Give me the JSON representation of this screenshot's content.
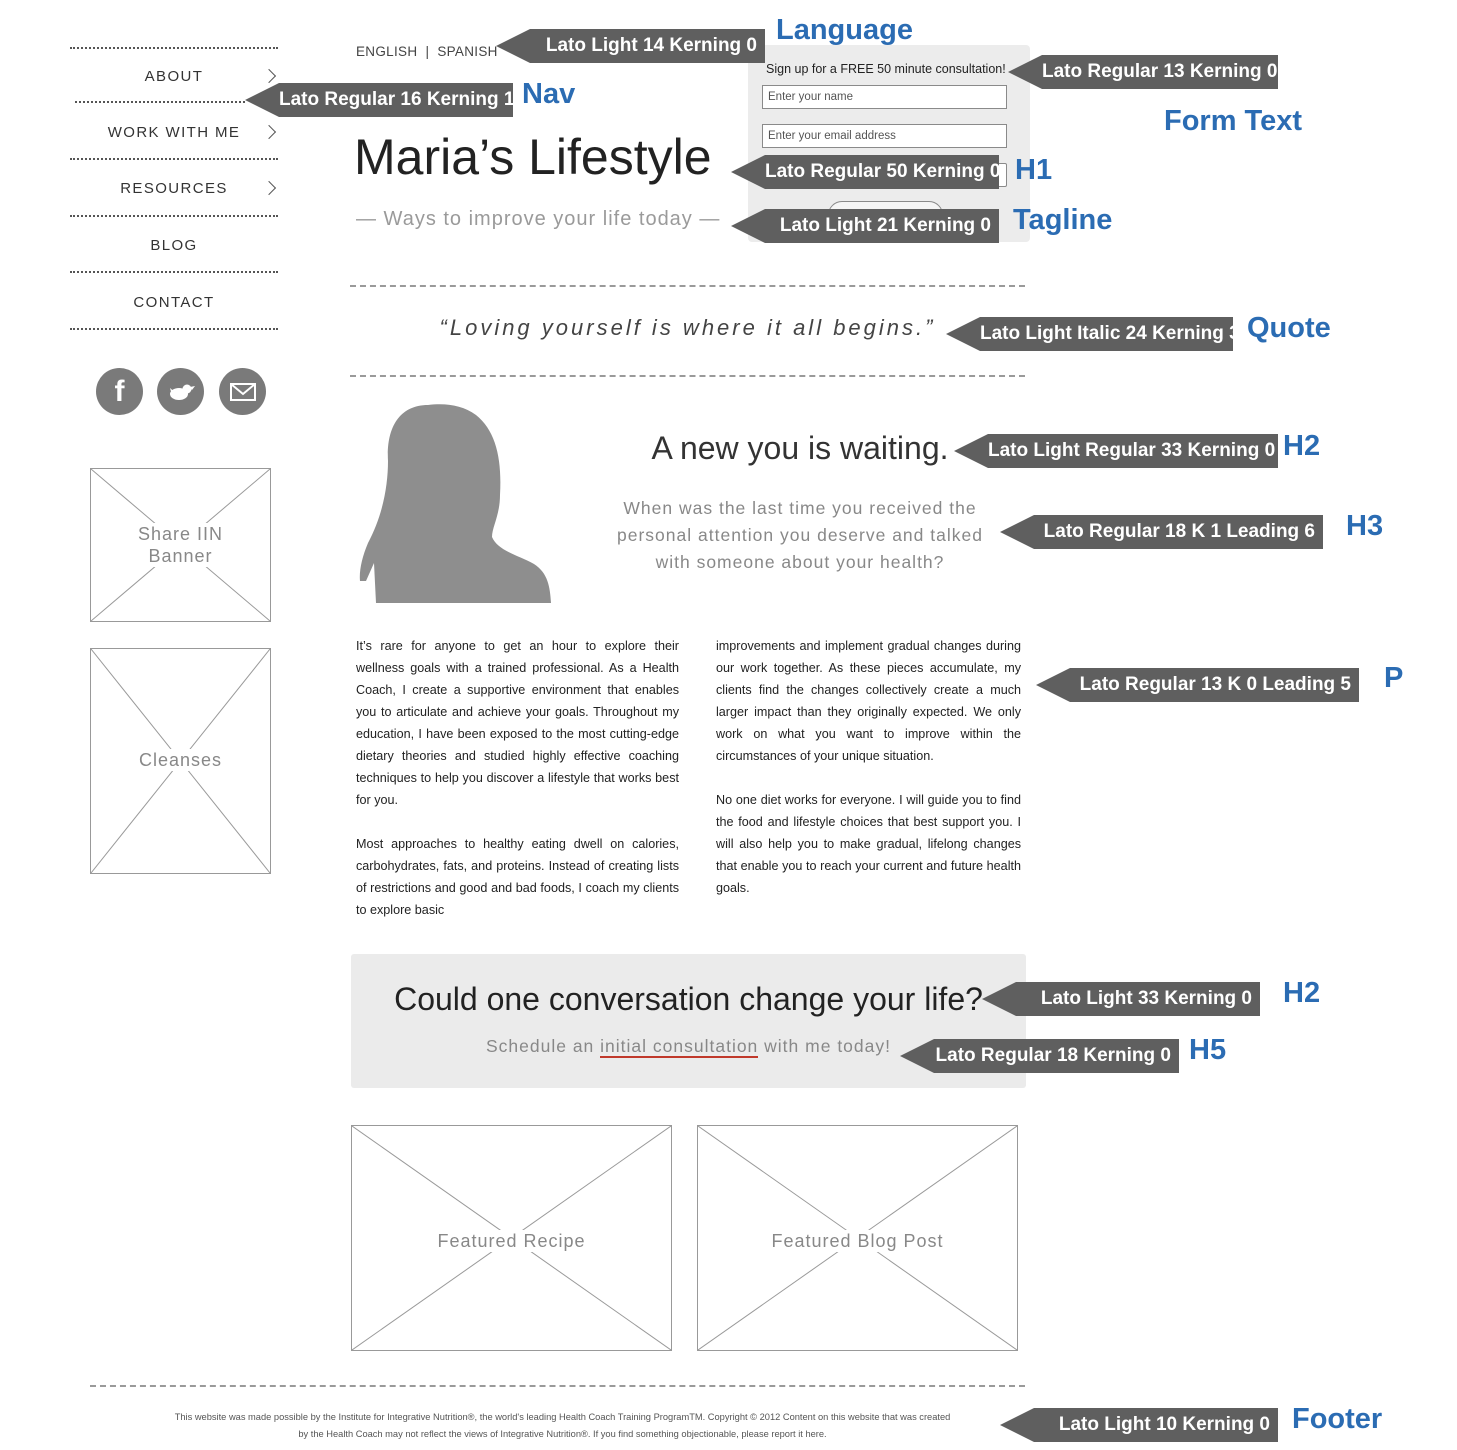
{
  "language": {
    "english": "ENGLISH",
    "separator": "|",
    "spanish": "SPANISH"
  },
  "nav": {
    "items": [
      {
        "label": "ABOUT"
      },
      {
        "label": "WORK WITH ME"
      },
      {
        "label": "RESOURCES"
      },
      {
        "label": "BLOG"
      },
      {
        "label": "CONTACT"
      }
    ]
  },
  "social": {
    "icons": [
      "facebook-icon",
      "twitter-icon",
      "email-icon"
    ]
  },
  "sidebar": {
    "banner1": "Share IIN Banner",
    "banner2": "Cleanses"
  },
  "form": {
    "heading": "Sign up for a FREE 50 minute consultation!",
    "name_placeholder": "Enter your name",
    "email_placeholder": "Enter your email address"
  },
  "header": {
    "title": "Maria’s Lifestyle",
    "tagline": "— Ways to improve your life today —"
  },
  "quote": "“Loving yourself is where it all begins.”",
  "intro": {
    "heading": "A new you is waiting.",
    "subheading": "When was the last time you received the personal attention you deserve and talked with someone about your health?"
  },
  "body": {
    "p1": "It’s rare for anyone to get an hour to explore their wellness goals with a trained professional. As a Health Coach, I create a supportive environment that enables you to articulate and achieve your goals. Throughout my education, I have been exposed to the most cutting-edge dietary theories and studied highly effective coaching techniques to help you discover a lifestyle that works best for you.",
    "p2": "Most approaches to healthy eating dwell on calories, carbohydrates, fats, and proteins. Instead of creating lists of restrictions and good and bad foods, I coach my clients to explore basic",
    "p3": "improvements and implement gradual changes during our work together. As these pieces accumulate, my clients find the changes collectively create a much larger impact than they originally expected. We only work on what you want to improve within the circumstances of your unique situation.",
    "p4": "No one diet works for everyone. I will guide you to find the food and lifestyle choices that best support you. I will also help you to make gradual, lifelong changes that enable you to reach your current and future health goals."
  },
  "cta": {
    "heading": "Could one conversation change your life?",
    "pre": "Schedule an ",
    "link": "initial consultation",
    "post": " with me today!"
  },
  "featured": {
    "recipe": "Featured Recipe",
    "blog": "Featured Blog Post"
  },
  "footer": {
    "line1": "This website was made possible by the Institute for Integrative Nutrition®, the world's leading Health Coach Training ProgramTM. Copyright © 2012 Content on this website that was created",
    "line2": "by the Health Coach may not reflect the views of Integrative Nutrition®. If you find something objectionable, please report it here."
  },
  "annotations": {
    "language": {
      "spec": "Lato Light 14 Kerning 0",
      "label": "Language"
    },
    "nav": {
      "spec": "Lato Regular 16  Kerning 1",
      "label": "Nav"
    },
    "form": {
      "spec": "Lato Regular 13 Kerning 0",
      "label": "Form Text"
    },
    "h1": {
      "spec": "Lato Regular 50 Kerning 0",
      "label": "H1"
    },
    "tagline": {
      "spec": "Lato Light 21 Kerning 0",
      "label": "Tagline"
    },
    "quote": {
      "spec": "Lato Light Italic 24 Kerning 3",
      "label": "Quote"
    },
    "h2a": {
      "spec": "Lato Light Regular 33  Kerning 0",
      "label": "H2"
    },
    "h3": {
      "spec": "Lato Regular 18 K 1 Leading 6",
      "label": "H3"
    },
    "p": {
      "spec": "Lato Regular 13 K 0 Leading 5",
      "label": "P"
    },
    "h2b": {
      "spec": "Lato Light 33 Kerning 0",
      "label": "H2"
    },
    "h5": {
      "spec": "Lato Regular 18 Kerning 0",
      "label": "H5"
    },
    "footer": {
      "spec": "Lato Light 10 Kerning 0",
      "label": "Footer"
    }
  }
}
